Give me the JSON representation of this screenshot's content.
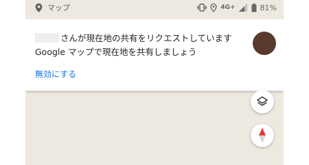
{
  "status_bar": {
    "app_label": "マップ",
    "network": "4G+",
    "battery": "81%"
  },
  "notification": {
    "line1": "さんが現在地の共有をリクエストしています",
    "line2": "Google マップで現在地を共有しましょう",
    "action": "無効にする"
  },
  "colors": {
    "accent": "#1a73e8",
    "map_bg": "#ede9e0",
    "avatar": "#5a3a2e",
    "compass_red": "#e53935"
  },
  "icons": [
    "location-pin-icon",
    "vibrate-icon",
    "location-icon",
    "signal-icon",
    "battery-icon",
    "layers-icon",
    "compass-icon"
  ]
}
